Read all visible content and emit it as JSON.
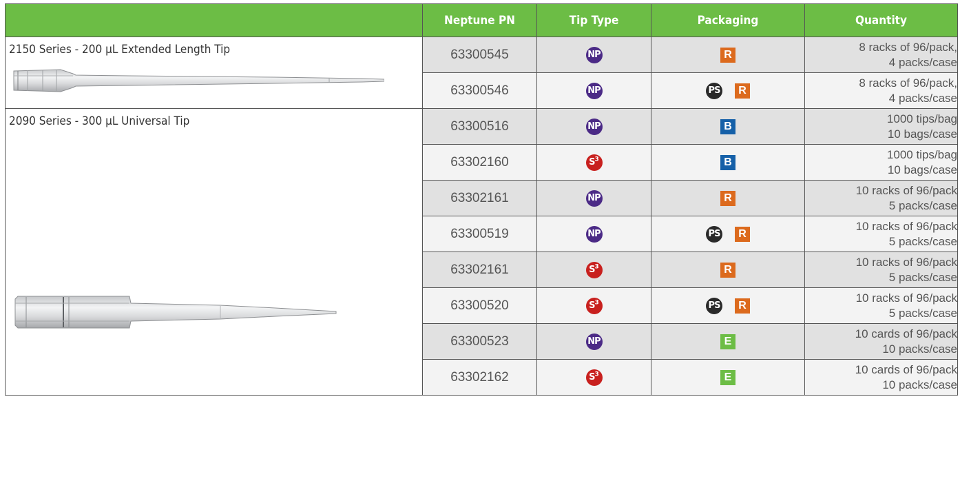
{
  "header": {
    "blank": "",
    "col_pn": "Neptune PN",
    "col_tip_type": "Tip Type",
    "col_packaging": "Packaging",
    "col_quantity": "Quantity"
  },
  "colors": {
    "header_green": "#6cbd45",
    "badge_NP": "#4b2a86",
    "badge_S3": "#c8201e",
    "badge_PS": "#2a2a2a",
    "pack_R": "#dc6a1d",
    "pack_B": "#1560a8",
    "pack_E": "#6cbd45"
  },
  "products": [
    {
      "title": "2150 Series - 200 µL Extended Length Tip"
    },
    {
      "title": "2090 Series - 300 µL Universal Tip"
    }
  ],
  "rows": [
    {
      "pn": "63300545",
      "tip": {
        "label": "NP",
        "sup": "",
        "icon": "np-tip-icon",
        "color": "#4b2a86"
      },
      "ps": "",
      "pack": {
        "label": "R",
        "icon": "rack-packaging-icon",
        "color": "#dc6a1d"
      },
      "qty": [
        "8 racks of 96/pack,",
        "4 packs/case"
      ]
    },
    {
      "pn": "63300546",
      "tip": {
        "label": "NP",
        "sup": "",
        "icon": "np-tip-icon",
        "color": "#4b2a86"
      },
      "ps": "PS",
      "pack": {
        "label": "R",
        "icon": "rack-packaging-icon",
        "color": "#dc6a1d"
      },
      "qty": [
        "8 racks of 96/pack,",
        "4 packs/case"
      ]
    },
    {
      "pn": "63300516",
      "tip": {
        "label": "NP",
        "sup": "",
        "icon": "np-tip-icon",
        "color": "#4b2a86"
      },
      "ps": "",
      "pack": {
        "label": "B",
        "icon": "bag-packaging-icon",
        "color": "#1560a8"
      },
      "qty": [
        "1000 tips/bag",
        "10 bags/case"
      ]
    },
    {
      "pn": "63302160",
      "tip": {
        "label": "S",
        "sup": "3",
        "icon": "s3-tip-icon",
        "color": "#c8201e"
      },
      "ps": "",
      "pack": {
        "label": "B",
        "icon": "bag-packaging-icon",
        "color": "#1560a8"
      },
      "qty": [
        "1000 tips/bag",
        "10 bags/case"
      ]
    },
    {
      "pn": "63302161",
      "tip": {
        "label": "NP",
        "sup": "",
        "icon": "np-tip-icon",
        "color": "#4b2a86"
      },
      "ps": "",
      "pack": {
        "label": "R",
        "icon": "rack-packaging-icon",
        "color": "#dc6a1d"
      },
      "qty": [
        "10 racks of 96/pack",
        "5 packs/case"
      ]
    },
    {
      "pn": "63300519",
      "tip": {
        "label": "NP",
        "sup": "",
        "icon": "np-tip-icon",
        "color": "#4b2a86"
      },
      "ps": "PS",
      "pack": {
        "label": "R",
        "icon": "rack-packaging-icon",
        "color": "#dc6a1d"
      },
      "qty": [
        "10 racks of 96/pack",
        "5 packs/case"
      ]
    },
    {
      "pn": "63302161",
      "tip": {
        "label": "S",
        "sup": "3",
        "icon": "s3-tip-icon",
        "color": "#c8201e"
      },
      "ps": "",
      "pack": {
        "label": "R",
        "icon": "rack-packaging-icon",
        "color": "#dc6a1d"
      },
      "qty": [
        "10 racks of 96/pack",
        "5 packs/case"
      ]
    },
    {
      "pn": "63300520",
      "tip": {
        "label": "S",
        "sup": "3",
        "icon": "s3-tip-icon",
        "color": "#c8201e"
      },
      "ps": "PS",
      "pack": {
        "label": "R",
        "icon": "rack-packaging-icon",
        "color": "#dc6a1d"
      },
      "qty": [
        "10 racks of 96/pack",
        "5 packs/case"
      ]
    },
    {
      "pn": "63300523",
      "tip": {
        "label": "NP",
        "sup": "",
        "icon": "np-tip-icon",
        "color": "#4b2a86"
      },
      "ps": "",
      "pack": {
        "label": "E",
        "icon": "easy-load-packaging-icon",
        "color": "#6cbd45"
      },
      "qty": [
        "10 cards of 96/pack",
        "10 packs/case"
      ]
    },
    {
      "pn": "63302162",
      "tip": {
        "label": "S",
        "sup": "3",
        "icon": "s3-tip-icon",
        "color": "#c8201e"
      },
      "ps": "",
      "pack": {
        "label": "E",
        "icon": "easy-load-packaging-icon",
        "color": "#6cbd45"
      },
      "qty": [
        "10 cards of 96/pack",
        "10 packs/case"
      ]
    }
  ]
}
